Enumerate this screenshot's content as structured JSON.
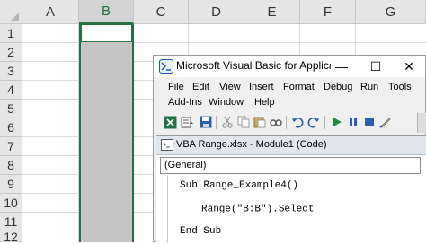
{
  "sheet": {
    "columns": [
      "A",
      "B",
      "C",
      "D",
      "E",
      "F",
      "G"
    ],
    "selected_column": "B",
    "rows": [
      "1",
      "2",
      "3",
      "4",
      "5",
      "6",
      "7",
      "8",
      "9",
      "10",
      "11",
      "12"
    ]
  },
  "vbe": {
    "title": "Microsoft Visual Basic for Applicatio...",
    "window_buttons": {
      "minimize": "—",
      "restore": "☐",
      "close": "✕"
    },
    "menu_row1": [
      "File",
      "Edit",
      "View",
      "Insert",
      "Format",
      "Debug",
      "Run",
      "Tools"
    ],
    "menu_row2": [
      "Add-Ins",
      "Window",
      "Help"
    ],
    "code_window_title": "VBA Range.xlsx - Module1 (Code)",
    "object_dropdown": "(General)",
    "code_lines": [
      "Sub Range_Example4()",
      "Range(\"B:B\").Select",
      "End Sub"
    ]
  },
  "colors": {
    "excel_green": "#217346",
    "selection_gray": "#c6c6c6"
  }
}
